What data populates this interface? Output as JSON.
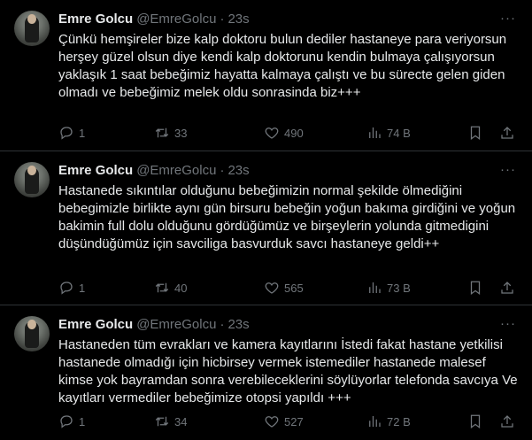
{
  "tweets": [
    {
      "name": "Emre Golcu",
      "handle": "@EmreGolcu",
      "dot": "·",
      "time": "23s",
      "more": "···",
      "text": "Çünkü hemşireler bize kalp doktoru bulun dediler hastaneye para veriyorsun herşey güzel olsun diye kendi kalp doktorunu kendin bulmaya çalışıyorsun yaklaşık 1 saat bebeğimiz hayatta kalmaya çalıştı ve bu sürecte gelen giden olmadı ve bebeğimiz melek oldu sonrasinda biz+++",
      "replies": "1",
      "retweets": "33",
      "likes": "490",
      "views": "74 B"
    },
    {
      "name": "Emre Golcu",
      "handle": "@EmreGolcu",
      "dot": "·",
      "time": "23s",
      "more": "···",
      "text": "Hastanede sıkıntılar olduğunu bebeğimizin normal şekilde ölmediğini bebegimizle birlikte aynı gün birsuru bebeğin yoğun bakıma girdiğini ve yoğun bakimin full dolu olduğunu gördüğümüz ve birşeylerin yolunda gitmedigini düşündüğümüz için savciliga basvurduk savcı hastaneye geldi++",
      "replies": "1",
      "retweets": "40",
      "likes": "565",
      "views": "73 B"
    },
    {
      "name": "Emre Golcu",
      "handle": "@EmreGolcu",
      "dot": "·",
      "time": "23s",
      "more": "···",
      "text": "Hastaneden tüm evrakları ve kamera kayıtlarını İstedi fakat hastane yetkilisi hastanede olmadığı için hicbirsey vermek istemediler hastanede malesef kimse yok bayramdan sonra verebileceklerini söylüyorlar telefonda savcıya Ve kayıtları vermediler bebeğimize otopsi yapıldı +++",
      "replies": "1",
      "retweets": "34",
      "likes": "527",
      "views": "72 B"
    }
  ],
  "colors": {
    "background": "#000000",
    "text": "#e7e9ea",
    "muted": "#71767b",
    "divider": "#2f3336"
  },
  "icons": [
    "reply-icon",
    "retweet-icon",
    "like-icon",
    "views-icon",
    "bookmark-icon",
    "share-icon",
    "more-icon"
  ]
}
